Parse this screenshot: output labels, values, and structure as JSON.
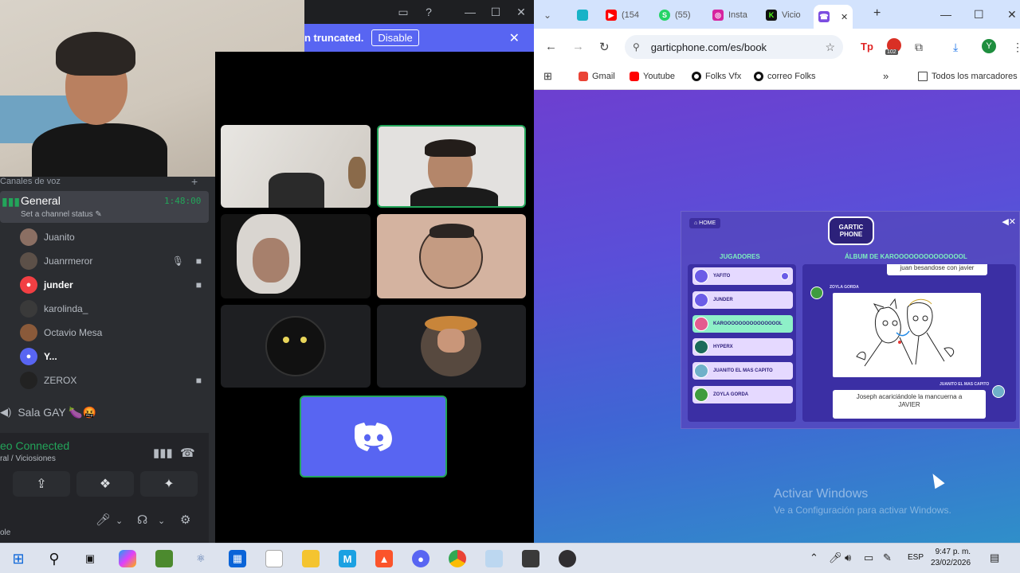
{
  "discord": {
    "banner": {
      "text": "n truncated.",
      "button": "Disable",
      "close": "✕"
    },
    "window_controls": {
      "mini": "▭",
      "help": "?",
      "minimize": "—",
      "maximize": "☐",
      "close": "✕"
    },
    "sidebar": {
      "category": "Canales de voz",
      "category_add": "+",
      "voice_channel": {
        "name": "General",
        "timer": "1:48:00",
        "status": "Set a channel status ✎"
      },
      "members": [
        {
          "name": "Juanito"
        },
        {
          "name": "Juanrmeror"
        },
        {
          "name": "junder"
        },
        {
          "name": "karolinda_"
        },
        {
          "name": "Octavio Mesa"
        },
        {
          "name": "Y..."
        },
        {
          "name": "ZEROX"
        }
      ],
      "other_channel": "Sala GAY 🍆🤬"
    },
    "voice_panel": {
      "status": "eo Connected",
      "channel": "ral / Viciosiones",
      "footer": "ole"
    }
  },
  "browser": {
    "tabs": [
      {
        "label": ""
      },
      {
        "label": "(154"
      },
      {
        "label": "(55)"
      },
      {
        "label": "Insta"
      },
      {
        "label": "Vicio"
      },
      {
        "label": ""
      }
    ],
    "new_tab": "+",
    "window_controls": {
      "minimize": "—",
      "maximize": "☐",
      "close": "✕"
    },
    "url": "garticphone.com/es/book",
    "profile_initial": "Y",
    "ext_badge": "102",
    "bookmarks": [
      "Gmail",
      "Youtube",
      "Folks Vfx",
      "correo Folks"
    ],
    "bookmarks_more": "»",
    "all_bookmarks": "Todos los marcadores"
  },
  "gartic": {
    "home": "⌂ HOME",
    "logo": "GARTIC PHONE",
    "players_header": "JUGADORES",
    "album_header": "ÁLBUM DE KAROOOOOOOOOOOOOOL",
    "players": [
      {
        "name": "YAFITO",
        "highlight": false
      },
      {
        "name": "JUNDER",
        "highlight": false
      },
      {
        "name": "KAROOOOOOOOOOOOOOOL",
        "highlight": true
      },
      {
        "name": "HYPERX",
        "highlight": false
      },
      {
        "name": "JUANITO EL MAS CAPITO",
        "highlight": false
      },
      {
        "name": "ZOYLA GORDA",
        "highlight": false
      }
    ],
    "album": {
      "top_caption": "juan besandose con javier",
      "drawer_name": "ZOYLA GORDA",
      "writer_name": "JUANITO EL MAS CAPITO",
      "bottom_caption": "Joseph acariciándole la mancuerna a JAVIER"
    }
  },
  "windows": {
    "watermark_title": "Activar Windows",
    "watermark_sub": "Ve a Configuración para activar Windows.",
    "tray_lang": "ESP",
    "time": "9:47 p. m.",
    "date": "23/02/2026"
  }
}
